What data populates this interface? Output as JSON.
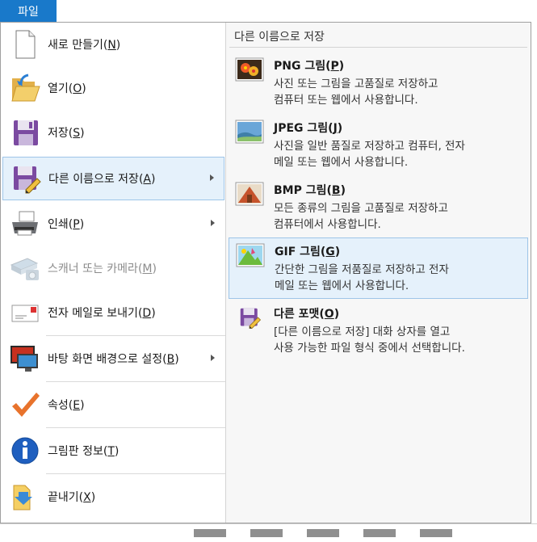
{
  "file_tab": {
    "label": "파일"
  },
  "menu": {
    "items": [
      {
        "label": "새로 만들기(N)",
        "label_main": "새로 만들기(",
        "mnemonic": "N",
        "icon": "new-document-icon",
        "enabled": true,
        "submenu": false
      },
      {
        "label": "열기(O)",
        "label_main": "열기(",
        "mnemonic": "O",
        "icon": "open-folder-icon",
        "enabled": true,
        "submenu": false
      },
      {
        "label": "저장(S)",
        "label_main": "저장(",
        "mnemonic": "S",
        "icon": "save-icon",
        "enabled": true,
        "submenu": false
      },
      {
        "label": "다른 이름으로 저장(A)",
        "label_main": "다른 이름으로 저장(",
        "mnemonic": "A",
        "icon": "save-as-icon",
        "enabled": true,
        "submenu": true,
        "highlighted": true
      },
      {
        "label": "인쇄(P)",
        "label_main": "인쇄(",
        "mnemonic": "P",
        "icon": "printer-icon",
        "enabled": true,
        "submenu": true
      },
      {
        "label": "스캐너 또는 카메라(M)",
        "label_main": "스캐너 또는 카메라(",
        "mnemonic": "M",
        "icon": "scanner-camera-icon",
        "enabled": false,
        "submenu": false
      },
      {
        "label": "전자 메일로 보내기(D)",
        "label_main": "전자 메일로 보내기(",
        "mnemonic": "D",
        "icon": "email-icon",
        "enabled": true,
        "submenu": false
      },
      {
        "label": "바탕 화면 배경으로 설정(B)",
        "label_main": "바탕 화면 배경으로 설정(",
        "mnemonic": "B",
        "icon": "desktop-background-icon",
        "enabled": true,
        "submenu": true
      },
      {
        "label": "속성(E)",
        "label_main": "속성(",
        "mnemonic": "E",
        "icon": "checkmark-icon",
        "enabled": true,
        "submenu": false
      },
      {
        "label": "그림판 정보(T)",
        "label_main": "그림판 정보(",
        "mnemonic": "T",
        "icon": "info-icon",
        "enabled": true,
        "submenu": false
      },
      {
        "label": "끝내기(X)",
        "label_main": "끝내기(",
        "mnemonic": "X",
        "icon": "exit-icon",
        "enabled": true,
        "submenu": false
      }
    ]
  },
  "save_as": {
    "header": "다른 이름으로 저장",
    "options": [
      {
        "title_main": "PNG 그림(",
        "mnemonic": "P",
        "desc_line1": "사진 또는 그림을 고품질로 저장하고",
        "desc_line2": "컴퓨터 또는 웹에서 사용합니다.",
        "icon": "png-picture-icon"
      },
      {
        "title_main": "JPEG 그림(",
        "mnemonic": "J",
        "desc_line1": "사진을 일반 품질로 저장하고 컴퓨터, 전자",
        "desc_line2": "메일 또는 웹에서 사용합니다.",
        "icon": "jpeg-picture-icon"
      },
      {
        "title_main": "BMP 그림(",
        "mnemonic": "B",
        "desc_line1": "모든 종류의 그림을 고품질로 저장하고",
        "desc_line2": "컴퓨터에서 사용합니다.",
        "icon": "bmp-picture-icon"
      },
      {
        "title_main": "GIF 그림(",
        "mnemonic": "G",
        "desc_line1": "간단한 그림을 저품질로 저장하고 전자",
        "desc_line2": "메일 또는 웹에서 사용합니다.",
        "icon": "gif-picture-icon",
        "highlighted": true
      },
      {
        "title_main": "다른 포맷(",
        "mnemonic": "O",
        "desc_line1": "[다른 이름으로 저장] 대화 상자를 열고",
        "desc_line2": "사용 가능한 파일 형식 중에서 선택합니다.",
        "icon": "other-format-icon"
      }
    ]
  },
  "colors": {
    "accent": "#1979ca",
    "highlight_bg": "#e5f1fb",
    "highlight_border": "#9ec5e8",
    "disabled_text": "#8c8c8c"
  }
}
